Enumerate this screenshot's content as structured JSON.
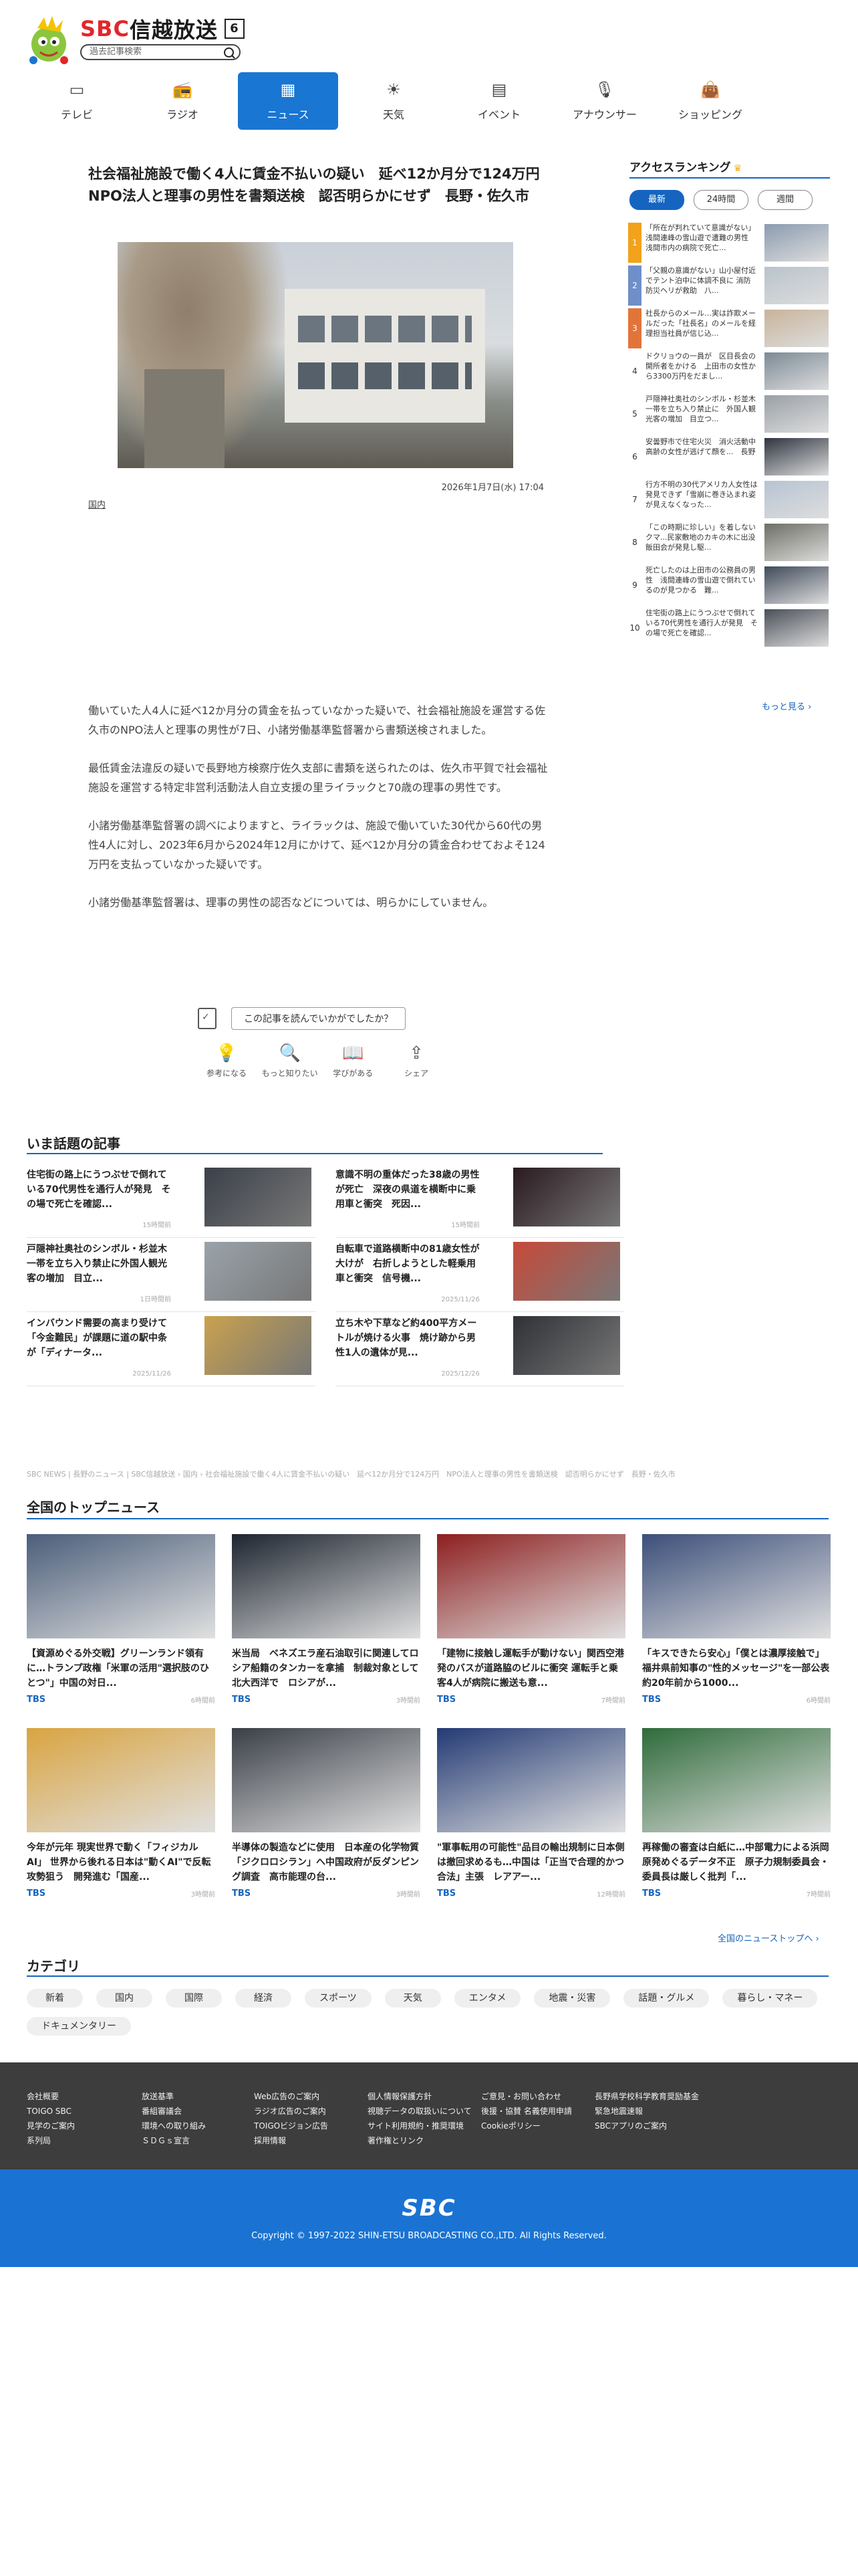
{
  "header": {
    "brand_latin": "SBC",
    "brand_jp": "信越放送",
    "channel": "6",
    "search_placeholder": "過去記事検索"
  },
  "nav": [
    {
      "label": "テレビ",
      "icon": "tv-icon",
      "active": false
    },
    {
      "label": "ラジオ",
      "icon": "radio-icon",
      "active": false
    },
    {
      "label": "ニュース",
      "icon": "news-icon",
      "active": true
    },
    {
      "label": "天気",
      "icon": "sun-icon",
      "active": false
    },
    {
      "label": "イベント",
      "icon": "calendar-icon",
      "active": false
    },
    {
      "label": "アナウンサー",
      "icon": "microphone-icon",
      "active": false
    },
    {
      "label": "ショッピング",
      "icon": "shopping-bag-icon",
      "active": false
    }
  ],
  "article": {
    "headline": "社会福祉施設で働く4人に賃金不払いの疑い　延べ12か月分で124万円　NPO法人と理事の男性を書類送検　認否明らかにせず　長野・佐久市",
    "date": "2026年1月7日(水) 17:04",
    "category": "国内",
    "paragraphs": [
      "働いていた人4人に延べ12か月分の賃金を払っていなかった疑いで、社会福祉施設を運営する佐久市のNPO法人と理事の男性が7日、小諸労働基準監督署から書類送検されました。",
      "最低賃金法違反の疑いで長野地方検察庁佐久支部に書類を送られたのは、佐久市平賀で社会福祉施設を運営する特定非営利活動法人自立支援の里ライラックと70歳の理事の男性です。",
      "小諸労働基準監督署の調べによりますと、ライラックは、施設で働いていた30代から60代の男性4人に対し、2023年6月から2024年12月にかけて、延べ12か月分の賃金合わせておよそ124万円を支払っていなかった疑いです。",
      "小諸労働基準監督署は、理事の男性の認否などについては、明らかにしていません。"
    ],
    "feedback_question": "この記事を読んでいかがでしたか？",
    "reactions": [
      {
        "label": "参考になる",
        "icon": "lightbulb-icon"
      },
      {
        "label": "もっと知りたい",
        "icon": "magnifier-icon"
      },
      {
        "label": "学びがある",
        "icon": "book-icon"
      },
      {
        "label": "シェア",
        "icon": "share-icon"
      }
    ]
  },
  "ranking": {
    "title": "アクセスランキング",
    "tabs": [
      "最新",
      "24時間",
      "週間"
    ],
    "active_tab": "最新",
    "more": "もっと見る ›",
    "items": [
      {
        "rank": "1",
        "text": "「所在が判れていて意識がない」浅間連峰の雪山遊で遭難の男性 浅間市内の病院で死亡...",
        "color": "#f2a21b",
        "thumb": "#8a9bb0"
      },
      {
        "rank": "2",
        "text": "「父親の意識がない」山小屋付近でテント泊中に体調不良に 消防防災ヘリが救助　八...",
        "color": "#6f8fca",
        "thumb": "#b9c3cc"
      },
      {
        "rank": "3",
        "text": "社長からのメール…実は詐欺メールだった「社長名」のメールを経理担当社員が信じ込...",
        "color": "#e2743a",
        "thumb": "#c9b39a"
      },
      {
        "rank": "4",
        "text": "ドクリョウの一員が　区目長会の開所者をかける　上田市の女性から3300万円をだまし...",
        "color": "",
        "thumb": "#7b8a96"
      },
      {
        "rank": "5",
        "text": "戸隠神社奥社のシンボル・杉並木一帯を立ち入り禁止に　外国人観光客の増加　目立つ...",
        "color": "",
        "thumb": "#9aa0a6"
      },
      {
        "rank": "6",
        "text": "安曇野市で住宅火災　消火活動中　高齢の女性が逃げて顔を...　長野",
        "color": "",
        "thumb": "#2e3440"
      },
      {
        "rank": "7",
        "text": "行方不明の30代アメリカ人女性は発見できず「雪崩に巻き込まれ姿が見えなくなった...",
        "color": "",
        "thumb": "#b7c4d3"
      },
      {
        "rank": "8",
        "text": "「この時期に珍しい」を着しないクマ...民家敷地のカキの木に出没　飯田会が発見し駆...",
        "color": "",
        "thumb": "#6c6f64"
      },
      {
        "rank": "9",
        "text": "死亡したのは上田市の公務員の男性　浅間連峰の雪山遊で倒れているのが見つかる　難...",
        "color": "",
        "thumb": "#3f4a5a"
      },
      {
        "rank": "10",
        "text": "住宅街の路上にうつぶせで倒れている70代男性を通行人が発見　その場で死亡を確認...",
        "color": "",
        "thumb": "#4a4f58"
      }
    ]
  },
  "trending": {
    "title": "いま話題の記事",
    "items": [
      {
        "title": "住宅街の路上にうつぶせで倒れている70代男性を通行人が発見　その場で死亡を確認...",
        "time": "15時間前",
        "thumb": "#3b4049"
      },
      {
        "title": "意識不明の重体だった38歳の男性が死亡　深夜の県道を横断中に乗用車と衝突　死因...",
        "time": "15時間前",
        "thumb": "#2a1a1f"
      },
      {
        "title": "戸隠神社奥社のシンボル・杉並木一帯を立ち入り禁止に外国人観光客の増加　目立...",
        "time": "1日時間前",
        "thumb": "#9aa3aa"
      },
      {
        "title": "自転車で道路横断中の81歳女性が大けが　右折しようとした軽乗用車と衝突　信号機...",
        "time": "2025/11/26",
        "thumb": "#c74a3a"
      },
      {
        "title": "インバウンド需要の高まり受けて「今金難民」が課題に道の駅中条が「ディナータ...",
        "time": "2025/11/26",
        "thumb": "#c9a24e"
      },
      {
        "title": "立ち木や下草など約400平方メートルが焼ける火事　焼け跡から男性1人の遺体が見...",
        "time": "2025/12/26",
        "thumb": "#2f3136"
      }
    ]
  },
  "breadcrumb": "SBC NEWS | 長野のニュース | SBC信越放送 › 国内 › 社会福祉施設で働く4人に賃金不払いの疑い　延べ12か月分で124万円　NPO法人と理事の男性を書類送検　認否明らかにせず　長野・佐久市",
  "top_news": {
    "title": "全国のトップニュース",
    "more": "全国のニューストップへ ›",
    "items": [
      {
        "title": "【資源めぐる外交戦】グリーンランド領有に…トランプ政権「米軍の活用\"選択肢のひとつ\"」中国の対日...",
        "src": "TBS",
        "time": "6時間前",
        "thumb": "#4b5e7a"
      },
      {
        "title": "米当局　ベネズエラ産石油取引に関連してロシア船籍のタンカーを拿捕　制裁対象として北大西洋で　ロシアが...",
        "src": "TBS",
        "time": "3時間前",
        "thumb": "#1d2530"
      },
      {
        "title": "「建物に接触し運転手が動けない」関西空港発のバスが道路脇のビルに衝突 運転手と乗客4人が病院に搬送も意...",
        "src": "TBS",
        "time": "7時間前",
        "thumb": "#8d1f1f"
      },
      {
        "title": "「キスできたら安心」「僕とは濃厚接触で」福井県前知事の\"性的メッセージ\"を一部公表　約20年前から1000...",
        "src": "TBS",
        "time": "6時間前",
        "thumb": "#3c4f7a"
      },
      {
        "title": "今年が元年 現実世界で動く「フィジカルAI」 世界から後れる日本は\"動くAI\"で反転攻勢狙う　開発進む「国産...",
        "src": "TBS",
        "time": "3時間前",
        "thumb": "#d9a441"
      },
      {
        "title": "半導体の製造などに使用　日本産の化学物質「ジクロロシラン」へ中国政府が反ダンピング調査　高市能理の台...",
        "src": "TBS",
        "time": "3時間前",
        "thumb": "#3a3f47"
      },
      {
        "title": "\"軍事転用の可能性\"品目の輸出規制に日本側は撤回求めるも…中国は「正当で合理的かつ合法」主張　レアアー...",
        "src": "TBS",
        "time": "12時間前",
        "thumb": "#233a74"
      },
      {
        "title": "再稼働の審査は白紙に…中部電力による浜岡原発めぐるデータ不正　原子力規制委員会・委員長は厳しく批判「...",
        "src": "TBS",
        "time": "7時間前",
        "thumb": "#2f6b3a"
      }
    ]
  },
  "categories": {
    "title": "カテゴリ",
    "items": [
      "新着",
      "国内",
      "国際",
      "経済",
      "スポーツ",
      "天気",
      "エンタメ",
      "地震・災害",
      "話題・グルメ",
      "暮らし・マネー",
      "ドキュメンタリー"
    ]
  },
  "footer": {
    "columns": [
      [
        "会社概要",
        "TOIGO SBC",
        "見学のご案内",
        "系列局"
      ],
      [
        "放送基準",
        "番組審議会",
        "環境への取り組み",
        "ＳＤＧｓ宣言"
      ],
      [
        "Web広告のご案内",
        "ラジオ広告のご案内",
        "TOIGOビジョン広告",
        "採用情報"
      ],
      [
        "個人情報保護方針",
        "視聴データの取扱いについて",
        "サイト利用規約・推奨環境",
        "著作権とリンク"
      ],
      [
        "ご意見・お問い合わせ",
        "後援・協賛 名義使用申請",
        "Cookieポリシー"
      ],
      [
        "長野県学校科学教育奨励基金",
        "緊急地震速報",
        "SBCアプリのご案内"
      ]
    ],
    "logo": "SBC",
    "copyright": "Copyright © 1997-2022 SHIN-ETSU BROADCASTING CO.,LTD. All Rights Reserved."
  },
  "colors": {
    "accent": "#1565c0",
    "nav_active": "#1976d2",
    "footer_dark": "#3d3d3d",
    "footer_blue": "#1a73d2"
  }
}
